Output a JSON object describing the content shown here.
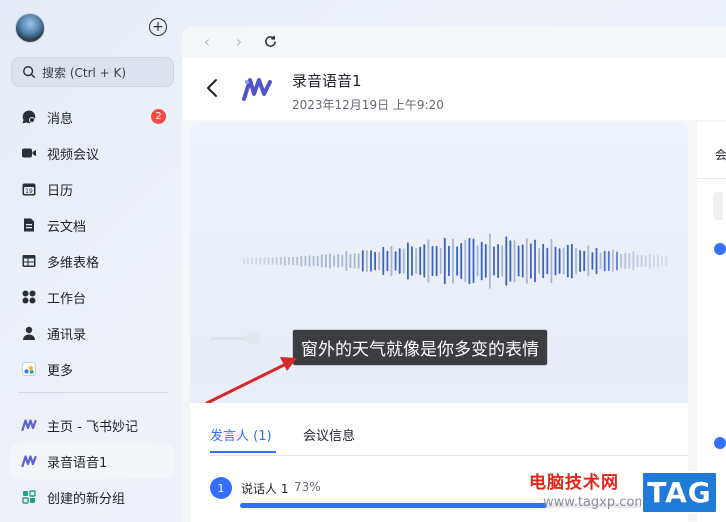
{
  "sidebar": {
    "search_placeholder": "搜索 (Ctrl + K)",
    "items": [
      {
        "label": "消息",
        "icon": "chat-bubble-icon",
        "badge": "2"
      },
      {
        "label": "视频会议",
        "icon": "video-camera-icon"
      },
      {
        "label": "日历",
        "icon": "calendar-icon"
      },
      {
        "label": "云文档",
        "icon": "document-icon"
      },
      {
        "label": "多维表格",
        "icon": "table-icon"
      },
      {
        "label": "工作台",
        "icon": "apps-grid-icon"
      },
      {
        "label": "通讯录",
        "icon": "contacts-icon"
      },
      {
        "label": "更多",
        "icon": "more-icon"
      }
    ],
    "pinned": [
      {
        "label": "主页 - 飞书妙记",
        "icon": "minutes-logo-icon"
      },
      {
        "label": "录音语音1",
        "icon": "minutes-logo-icon"
      },
      {
        "label": "创建的新分组",
        "icon": "group-icon"
      }
    ]
  },
  "header": {
    "title": "录音语音1",
    "date": "2023年12月19日 上午9:20"
  },
  "player": {
    "subtitle": "窗外的天气就像是你多变的表情"
  },
  "tabs": [
    {
      "label": "发言人 (1)",
      "active": true
    },
    {
      "label": "会议信息",
      "active": false
    }
  ],
  "speakers": [
    {
      "number": "1",
      "name": "说话人 1",
      "share": "73%",
      "share_fraction": 0.73
    }
  ],
  "right_panel": {
    "label": "会"
  },
  "watermark": {
    "site_name": "电脑技术网",
    "url": "www.tagxp.com",
    "tag": "TAG"
  },
  "colors": {
    "accent": "#3370ff",
    "badge": "#f54a45",
    "arrow": "#d42a2a"
  }
}
